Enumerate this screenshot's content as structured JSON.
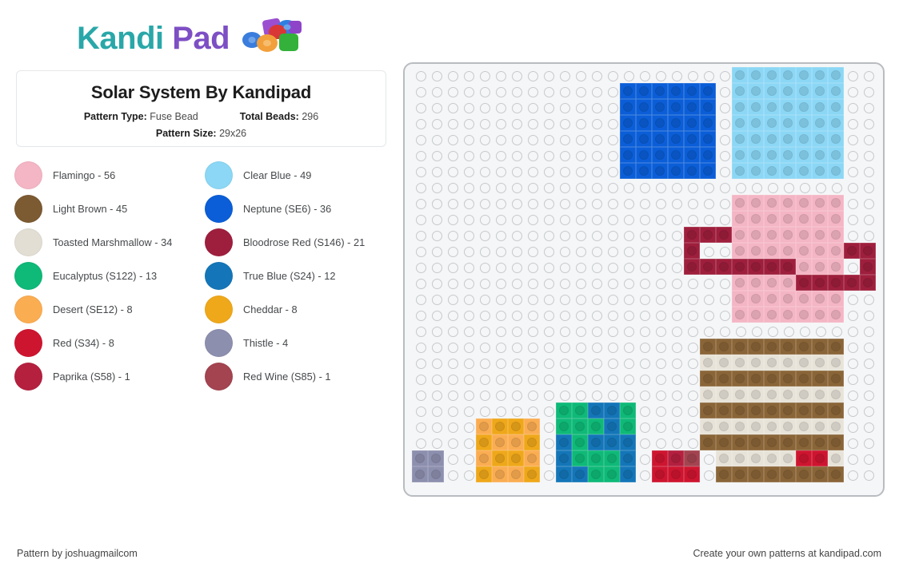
{
  "brand": {
    "name_part1": "Kandi",
    "name_part2": " Pad",
    "logo_icon": "beads-cluster-icon",
    "color_teal": "#2aa7a8",
    "color_purple": "#7d4fc4"
  },
  "info": {
    "title": "Solar System By Kandipad",
    "pattern_type_label": "Pattern Type:",
    "pattern_type_value": "Fuse Bead",
    "total_beads_label": "Total Beads:",
    "total_beads_value": "296",
    "pattern_size_label": "Pattern Size:",
    "pattern_size_value": "29x26"
  },
  "legend": {
    "items": [
      {
        "name": "Flamingo",
        "count": 56,
        "label": "Flamingo - 56",
        "color": "#f4b5c4"
      },
      {
        "name": "Clear Blue",
        "count": 49,
        "label": "Clear Blue - 49",
        "color": "#8bd7f5"
      },
      {
        "name": "Light Brown",
        "count": 45,
        "label": "Light Brown - 45",
        "color": "#7c5a32"
      },
      {
        "name": "Neptune (SE6)",
        "count": 36,
        "label": "Neptune (SE6) - 36",
        "color": "#0b5ed7"
      },
      {
        "name": "Toasted Marshmallow",
        "count": 34,
        "label": "Toasted Marshmallow - 34",
        "color": "#e2ded3"
      },
      {
        "name": "Bloodrose Red (S146)",
        "count": 21,
        "label": "Bloodrose Red (S146) - 21",
        "color": "#9e1f3d"
      },
      {
        "name": "Eucalyptus (S122)",
        "count": 13,
        "label": "Eucalyptus (S122) - 13",
        "color": "#0fb978"
      },
      {
        "name": "True Blue (S24)",
        "count": 12,
        "label": "True Blue (S24) - 12",
        "color": "#1476b8"
      },
      {
        "name": "Desert (SE12)",
        "count": 8,
        "label": "Desert (SE12) - 8",
        "color": "#fbad52"
      },
      {
        "name": "Cheddar",
        "count": 8,
        "label": "Cheddar - 8",
        "color": "#efa81a"
      },
      {
        "name": "Red (S34)",
        "count": 8,
        "label": "Red (S34) - 8",
        "color": "#ce1530"
      },
      {
        "name": "Thistle",
        "count": 4,
        "label": "Thistle - 4",
        "color": "#8d8fae"
      },
      {
        "name": "Paprika (S58)",
        "count": 1,
        "label": "Paprika (S58) - 1",
        "color": "#b5203f"
      },
      {
        "name": "Red Wine (S85)",
        "count": 1,
        "label": "Red Wine (S85) - 1",
        "color": "#a34450"
      }
    ]
  },
  "board": {
    "cols": 29,
    "rows": 26,
    "empty_color": "#f5f6f7",
    "palette": {
      "FL": "#f4b5c4",
      "CB": "#8bd7f5",
      "LB": "#8a6538",
      "NE": "#0b5ed7",
      "TM": "#e7e3d8",
      "BR": "#9e1f3d",
      "EU": "#0fb978",
      "TB": "#1476b8",
      "DE": "#fbad52",
      "CH": "#efa81a",
      "RD": "#ce1530",
      "TH": "#8d8fae",
      "PA": "#b5203f",
      "RW": "#a34450"
    },
    "rows_data": [
      "....................CBCBCBCBCBCBCB..",
      ".............NENENENENENE.CBCBCBCBCBCBCB..",
      ".............NENENENENENE.CBCBCBCBCBCBCB..",
      ".............NENENENENENE.CBCBCBCBCBCBCB..",
      ".............NENENENENENE.CBCBCBCBCBCBCB..",
      ".............NENENENENENE.CBCBCBCBCBCBCB..",
      ".............NENENENENENE.CBCBCBCBCBCBCB..",
      ".............................",
      "....................FLFLFLFLFLFLFL..",
      "....................FLFLFLFLFLFLFL..",
      "................BRBRBRFLFLFLFLFLFLFL..",
      "................BR..FLFLFLFLFLFLFLBRBR",
      "................BRBRBRBRBRBRBRFLFLFLFL.BR",
      "....................FLFLFLFLBRBRBRBRBRBR",
      "....................FLFLFLFLFLFLFL..",
      "....................FLFLFLFLFLFLFL..",
      ".............................",
      ".................LBLBLBLBLBLBLBLBLB..",
      ".................TMTMTMTMTMTMTMTMTM..",
      ".................LBLBLBLBLBLBLBLBLB..",
      ".................TMTMTMTMTMTMTMTMTM..",
      "........EUEUTBTBEU.......LBLBLBLBLBLBLBLBLB..",
      "...DECHCHDE.EUEUEUTBEU...TMTMTMTMTMTMTMTMTM..",
      "...CHDEDECH.TBEUTBTBTB...LBLBLBLBLBLBLBLBLB..",
      "THTH.DECHCHDE.TBEUEUEUTB.RDRDRD.TMTMTMTMRDRDTMTM..",
      "THTH.CHDEDECH.TBTBEUEUTB.RDRDRD.LBLBLBLBLBLBLBLBLB.."
    ],
    "cells": [
      [
        "",
        "",
        "",
        "",
        "",
        "",
        "",
        "",
        "",
        "",
        "",
        "",
        "",
        "",
        "",
        "",
        "",
        "",
        "",
        "",
        "CB",
        "CB",
        "CB",
        "CB",
        "CB",
        "CB",
        "CB",
        "",
        ""
      ],
      [
        "",
        "",
        "",
        "",
        "",
        "",
        "",
        "",
        "",
        "",
        "",
        "",
        "",
        "NE",
        "NE",
        "NE",
        "NE",
        "NE",
        "NE",
        "",
        "CB",
        "CB",
        "CB",
        "CB",
        "CB",
        "CB",
        "CB",
        "",
        ""
      ],
      [
        "",
        "",
        "",
        "",
        "",
        "",
        "",
        "",
        "",
        "",
        "",
        "",
        "",
        "NE",
        "NE",
        "NE",
        "NE",
        "NE",
        "NE",
        "",
        "CB",
        "CB",
        "CB",
        "CB",
        "CB",
        "CB",
        "CB",
        "",
        ""
      ],
      [
        "",
        "",
        "",
        "",
        "",
        "",
        "",
        "",
        "",
        "",
        "",
        "",
        "",
        "NE",
        "NE",
        "NE",
        "NE",
        "NE",
        "NE",
        "",
        "CB",
        "CB",
        "CB",
        "CB",
        "CB",
        "CB",
        "CB",
        "",
        ""
      ],
      [
        "",
        "",
        "",
        "",
        "",
        "",
        "",
        "",
        "",
        "",
        "",
        "",
        "",
        "NE",
        "NE",
        "NE",
        "NE",
        "NE",
        "NE",
        "",
        "CB",
        "CB",
        "CB",
        "CB",
        "CB",
        "CB",
        "CB",
        "",
        ""
      ],
      [
        "",
        "",
        "",
        "",
        "",
        "",
        "",
        "",
        "",
        "",
        "",
        "",
        "",
        "NE",
        "NE",
        "NE",
        "NE",
        "NE",
        "NE",
        "",
        "CB",
        "CB",
        "CB",
        "CB",
        "CB",
        "CB",
        "CB",
        "",
        ""
      ],
      [
        "",
        "",
        "",
        "",
        "",
        "",
        "",
        "",
        "",
        "",
        "",
        "",
        "",
        "NE",
        "NE",
        "NE",
        "NE",
        "NE",
        "NE",
        "",
        "CB",
        "CB",
        "CB",
        "CB",
        "CB",
        "CB",
        "CB",
        "",
        ""
      ],
      [
        "",
        "",
        "",
        "",
        "",
        "",
        "",
        "",
        "",
        "",
        "",
        "",
        "",
        "",
        "",
        "",
        "",
        "",
        "",
        "",
        "",
        "",
        "",
        "",
        "",
        "",
        "",
        "",
        ""
      ],
      [
        "",
        "",
        "",
        "",
        "",
        "",
        "",
        "",
        "",
        "",
        "",
        "",
        "",
        "",
        "",
        "",
        "",
        "",
        "",
        "",
        "FL",
        "FL",
        "FL",
        "FL",
        "FL",
        "FL",
        "FL",
        "",
        ""
      ],
      [
        "",
        "",
        "",
        "",
        "",
        "",
        "",
        "",
        "",
        "",
        "",
        "",
        "",
        "",
        "",
        "",
        "",
        "",
        "",
        "",
        "FL",
        "FL",
        "FL",
        "FL",
        "FL",
        "FL",
        "FL",
        "",
        ""
      ],
      [
        "",
        "",
        "",
        "",
        "",
        "",
        "",
        "",
        "",
        "",
        "",
        "",
        "",
        "",
        "",
        "",
        "",
        "BR",
        "BR",
        "BR",
        "FL",
        "FL",
        "FL",
        "FL",
        "FL",
        "FL",
        "FL",
        "",
        ""
      ],
      [
        "",
        "",
        "",
        "",
        "",
        "",
        "",
        "",
        "",
        "",
        "",
        "",
        "",
        "",
        "",
        "",
        "",
        "BR",
        "",
        "",
        "FL",
        "FL",
        "FL",
        "FL",
        "FL",
        "FL",
        "FL",
        "BR",
        "BR"
      ],
      [
        "",
        "",
        "",
        "",
        "",
        "",
        "",
        "",
        "",
        "",
        "",
        "",
        "",
        "",
        "",
        "",
        "",
        "BR",
        "BR",
        "BR",
        "BR",
        "BR",
        "BR",
        "BR",
        "FL",
        "FL",
        "FL",
        "",
        "BR"
      ],
      [
        "",
        "",
        "",
        "",
        "",
        "",
        "",
        "",
        "",
        "",
        "",
        "",
        "",
        "",
        "",
        "",
        "",
        "",
        "",
        "",
        "FL",
        "FL",
        "FL",
        "FL",
        "BR",
        "BR",
        "BR",
        "BR",
        "BR"
      ],
      [
        "",
        "",
        "",
        "",
        "",
        "",
        "",
        "",
        "",
        "",
        "",
        "",
        "",
        "",
        "",
        "",
        "",
        "",
        "",
        "",
        "FL",
        "FL",
        "FL",
        "FL",
        "FL",
        "FL",
        "FL",
        "",
        ""
      ],
      [
        "",
        "",
        "",
        "",
        "",
        "",
        "",
        "",
        "",
        "",
        "",
        "",
        "",
        "",
        "",
        "",
        "",
        "",
        "",
        "",
        "FL",
        "FL",
        "FL",
        "FL",
        "FL",
        "FL",
        "FL",
        "",
        ""
      ],
      [
        "",
        "",
        "",
        "",
        "",
        "",
        "",
        "",
        "",
        "",
        "",
        "",
        "",
        "",
        "",
        "",
        "",
        "",
        "",
        "",
        "",
        "",
        "",
        "",
        "",
        "",
        "",
        "",
        ""
      ],
      [
        "",
        "",
        "",
        "",
        "",
        "",
        "",
        "",
        "",
        "",
        "",
        "",
        "",
        "",
        "",
        "",
        "",
        "",
        "LB",
        "LB",
        "LB",
        "LB",
        "LB",
        "LB",
        "LB",
        "LB",
        "LB",
        "",
        ""
      ],
      [
        "",
        "",
        "",
        "",
        "",
        "",
        "",
        "",
        "",
        "",
        "",
        "",
        "",
        "",
        "",
        "",
        "",
        "",
        "TM",
        "TM",
        "TM",
        "TM",
        "TM",
        "TM",
        "TM",
        "TM",
        "TM",
        "",
        ""
      ],
      [
        "",
        "",
        "",
        "",
        "",
        "",
        "",
        "",
        "",
        "",
        "",
        "",
        "",
        "",
        "",
        "",
        "",
        "",
        "LB",
        "LB",
        "LB",
        "LB",
        "LB",
        "LB",
        "LB",
        "LB",
        "LB",
        "",
        ""
      ],
      [
        "",
        "",
        "",
        "",
        "",
        "",
        "",
        "",
        "",
        "",
        "",
        "",
        "",
        "",
        "",
        "",
        "",
        "",
        "TM",
        "TM",
        "TM",
        "TM",
        "TM",
        "TM",
        "TM",
        "TM",
        "TM",
        "",
        ""
      ],
      [
        "",
        "",
        "",
        "",
        "",
        "",
        "",
        "",
        "",
        "EU",
        "EU",
        "TB",
        "TB",
        "EU",
        "",
        "",
        "",
        "",
        "LB",
        "LB",
        "LB",
        "LB",
        "LB",
        "LB",
        "LB",
        "LB",
        "LB",
        "",
        ""
      ],
      [
        "",
        "",
        "",
        "",
        "DE",
        "CH",
        "CH",
        "DE",
        "",
        "EU",
        "EU",
        "EU",
        "TB",
        "EU",
        "",
        "",
        "",
        "",
        "TM",
        "TM",
        "TM",
        "TM",
        "TM",
        "TM",
        "TM",
        "TM",
        "TM",
        "",
        ""
      ],
      [
        "",
        "",
        "",
        "",
        "CH",
        "DE",
        "DE",
        "CH",
        "",
        "TB",
        "EU",
        "TB",
        "TB",
        "TB",
        "",
        "",
        "",
        "",
        "LB",
        "LB",
        "LB",
        "LB",
        "LB",
        "LB",
        "LB",
        "LB",
        "LB",
        "",
        ""
      ],
      [
        "TH",
        "TH",
        "",
        "",
        "DE",
        "CH",
        "CH",
        "DE",
        "",
        "TB",
        "EU",
        "EU",
        "EU",
        "TB",
        "",
        "RD",
        "PA",
        "RW",
        "",
        "TM",
        "TM",
        "TM",
        "TM",
        "TM",
        "RD",
        "RD",
        "TM",
        "",
        ""
      ],
      [
        "TH",
        "TH",
        "",
        "",
        "CH",
        "DE",
        "DE",
        "CH",
        "",
        "TB",
        "TB",
        "EU",
        "EU",
        "TB",
        "",
        "RD",
        "RD",
        "RD",
        "",
        "LB",
        "LB",
        "LB",
        "LB",
        "LB",
        "LB",
        "LB",
        "LB",
        "",
        ""
      ]
    ]
  },
  "footer": {
    "left": "Pattern by joshuagmailcom",
    "right": "Create your own patterns at kandipad.com"
  }
}
